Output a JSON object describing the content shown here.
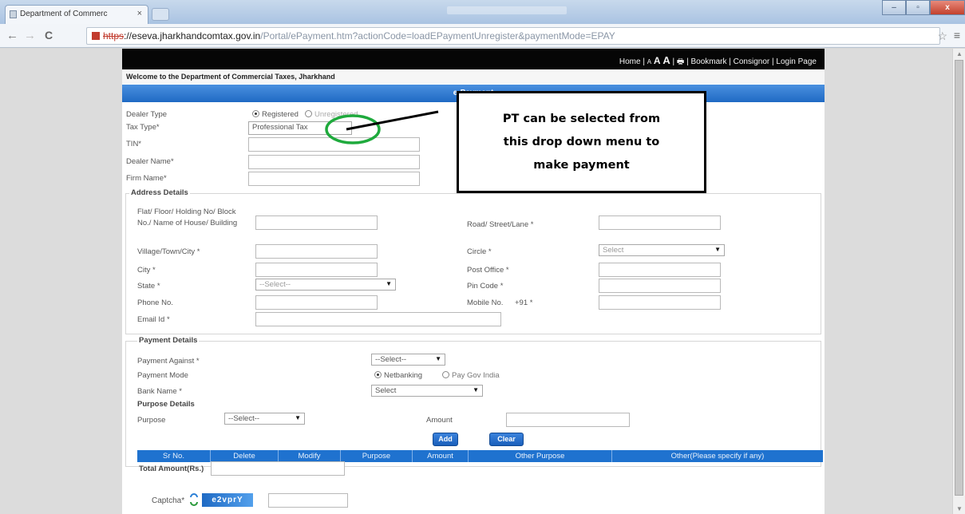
{
  "browser": {
    "tab_title": "Department of Commerc",
    "tab_close": "×",
    "url_scheme": "https",
    "url_host": "://eseva.jharkhandcomtax.gov.in",
    "url_path": "/Portal/ePayment.htm?actionCode=loadEPaymentUnregister&paymentMode=EPAY",
    "nav_back": "←",
    "nav_forward": "→",
    "nav_reload": "C",
    "star": "☆",
    "menu": "≡",
    "window_buttons": [
      "–",
      "▫",
      "x"
    ]
  },
  "site": {
    "top_links": {
      "home": "Home",
      "sep1": " | ",
      "font_small": "A",
      "font_mid": "A",
      "font_large": "A",
      "sep2": " | ",
      "print_icon": "🖶",
      "sep3": " | ",
      "bookmark": "Bookmark",
      "sep4": " | ",
      "consignor": "Consignor",
      "sep5": " | ",
      "login": "Login Page"
    },
    "welcome_text": "Welcome to the Department of Commercial Taxes, Jharkhand",
    "banner_title": "e-Payment"
  },
  "form": {
    "dealer_type_label": "Dealer Type",
    "dealer_type_options": [
      "Registered",
      "Unregistered"
    ],
    "tax_type_label": "Tax Type*",
    "tax_type_value": "Professional Tax",
    "tin_label": "TIN*",
    "dealer_name_label": "Dealer Name*",
    "firm_name_label": "Firm Name*",
    "address": {
      "legend": "Address Details",
      "flat_label_1": "Flat/ Floor/ Holding No/ Block",
      "flat_label_2": "No./ Name of House/ Building",
      "road_label": "Road/ Street/Lane *",
      "village_label": "Village/Town/City *",
      "circle_label": "Circle *",
      "circle_value": "Select",
      "city_label": "City *",
      "post_office_label": "Post Office *",
      "state_label": "State *",
      "state_value": "--Select--",
      "pin_label": "Pin Code *",
      "phone_label": "Phone No.",
      "mobile_label": "Mobile No.",
      "mobile_prefix": "+91 *",
      "email_label": "Email Id *"
    },
    "payment": {
      "legend": "Payment Details",
      "against_label": "Payment Against *",
      "against_value": "--Select--",
      "mode_label": "Payment Mode",
      "mode_options": [
        "Netbanking",
        "Pay Gov India"
      ],
      "bank_label": "Bank Name *",
      "bank_value": "Select",
      "purpose_details_label": "Purpose Details",
      "purpose_label": "Purpose",
      "purpose_value": "--Select--",
      "amount_label": "Amount",
      "add_button": "Add",
      "clear_button": "Clear",
      "table_headers": [
        "Sr No.",
        "Delete",
        "Modify",
        "Purpose",
        "Amount",
        "Other Purpose",
        "Other(Please specify if any)"
      ],
      "total_label": "Total Amount(Rs.)"
    },
    "captcha_label": "Captcha*",
    "captcha_text": "e2vprY"
  },
  "annotation": {
    "line1": "PT can be selected from",
    "line2": "this drop down menu to",
    "line3": "make payment",
    "circle_color": "#1faa3d",
    "pointer_color": "#000000"
  }
}
